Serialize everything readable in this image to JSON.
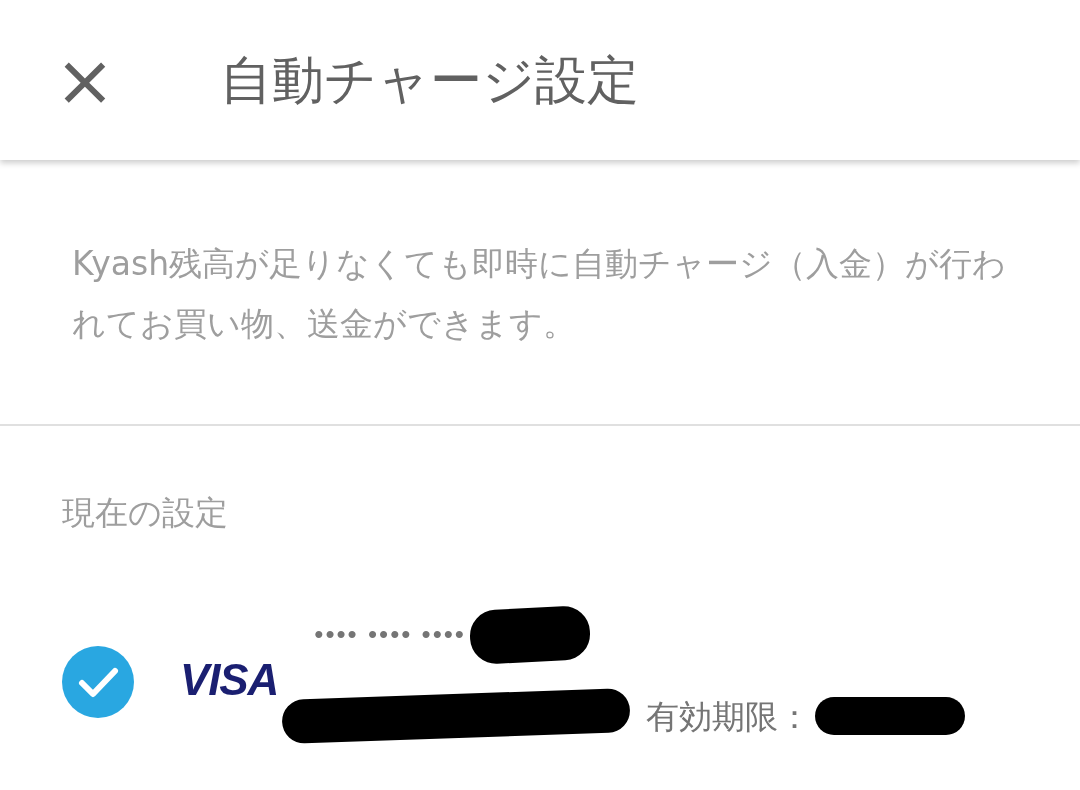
{
  "header": {
    "close_icon": "×",
    "title": "自動チャージ設定"
  },
  "description": "Kyash残高が足りなくても即時に自動チャージ（入金）が行われてお買い物、送金ができます。",
  "current_setting": {
    "heading": "現在の設定",
    "card": {
      "selected": true,
      "brand": "VISA",
      "masked_number": "•••• •••• ••••",
      "expiry_label": "有効期限："
    }
  }
}
